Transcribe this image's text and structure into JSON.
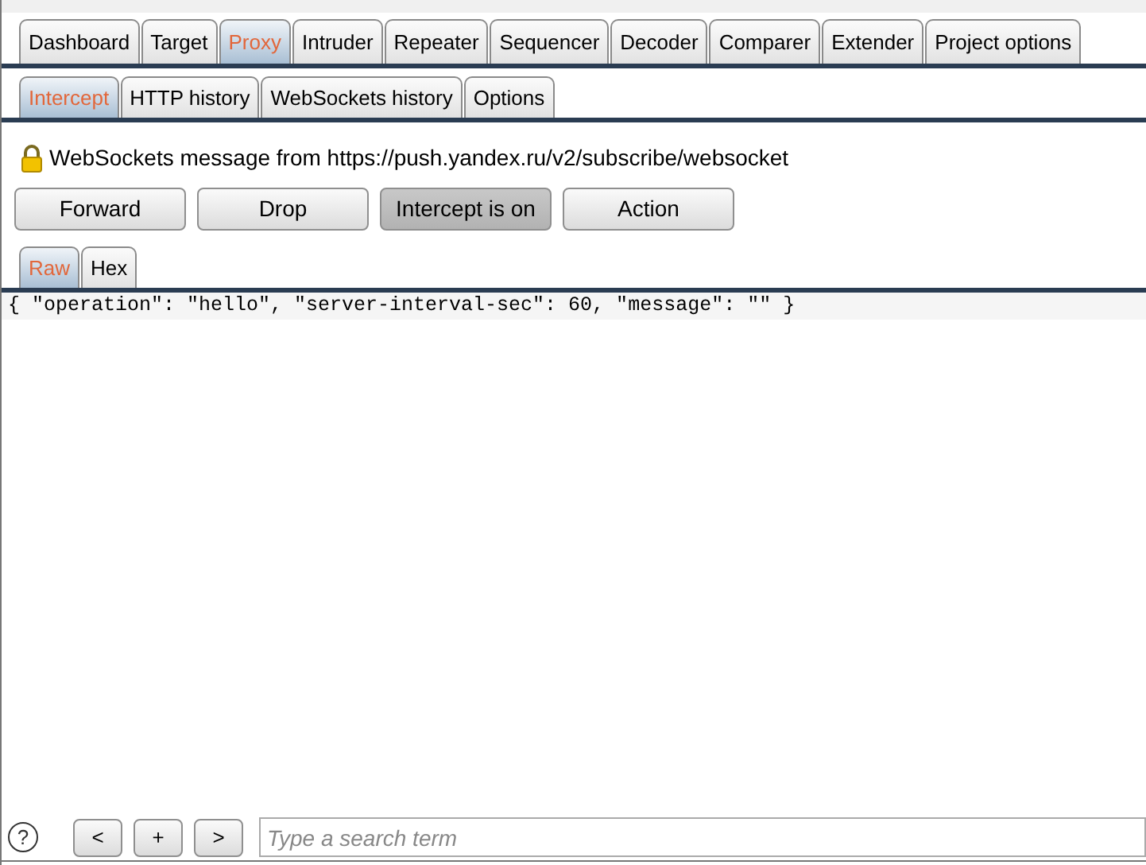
{
  "main_tabs": [
    {
      "label": "Dashboard",
      "selected": false
    },
    {
      "label": "Target",
      "selected": false
    },
    {
      "label": "Proxy",
      "selected": true
    },
    {
      "label": "Intruder",
      "selected": false
    },
    {
      "label": "Repeater",
      "selected": false
    },
    {
      "label": "Sequencer",
      "selected": false
    },
    {
      "label": "Decoder",
      "selected": false
    },
    {
      "label": "Comparer",
      "selected": false
    },
    {
      "label": "Extender",
      "selected": false
    },
    {
      "label": "Project options",
      "selected": false
    }
  ],
  "sub_tabs": [
    {
      "label": "Intercept",
      "selected": true
    },
    {
      "label": "HTTP history",
      "selected": false
    },
    {
      "label": "WebSockets history",
      "selected": false
    },
    {
      "label": "Options",
      "selected": false
    }
  ],
  "message_header": "WebSockets message from https://push.yandex.ru/v2/subscribe/websocket",
  "actions": [
    {
      "label": "Forward",
      "on": false
    },
    {
      "label": "Drop",
      "on": false
    },
    {
      "label": "Intercept is on",
      "on": true
    },
    {
      "label": "Action",
      "on": false
    }
  ],
  "view_tabs": [
    {
      "label": "Raw",
      "selected": true
    },
    {
      "label": "Hex",
      "selected": false
    }
  ],
  "editor": {
    "text": "{ \"operation\": \"hello\", \"server-interval-sec\": 60, \"message\": \"\" }"
  },
  "search_bar": {
    "help": "?",
    "nav_buttons": [
      "<",
      "+",
      ">"
    ],
    "placeholder": "Type a search term"
  }
}
